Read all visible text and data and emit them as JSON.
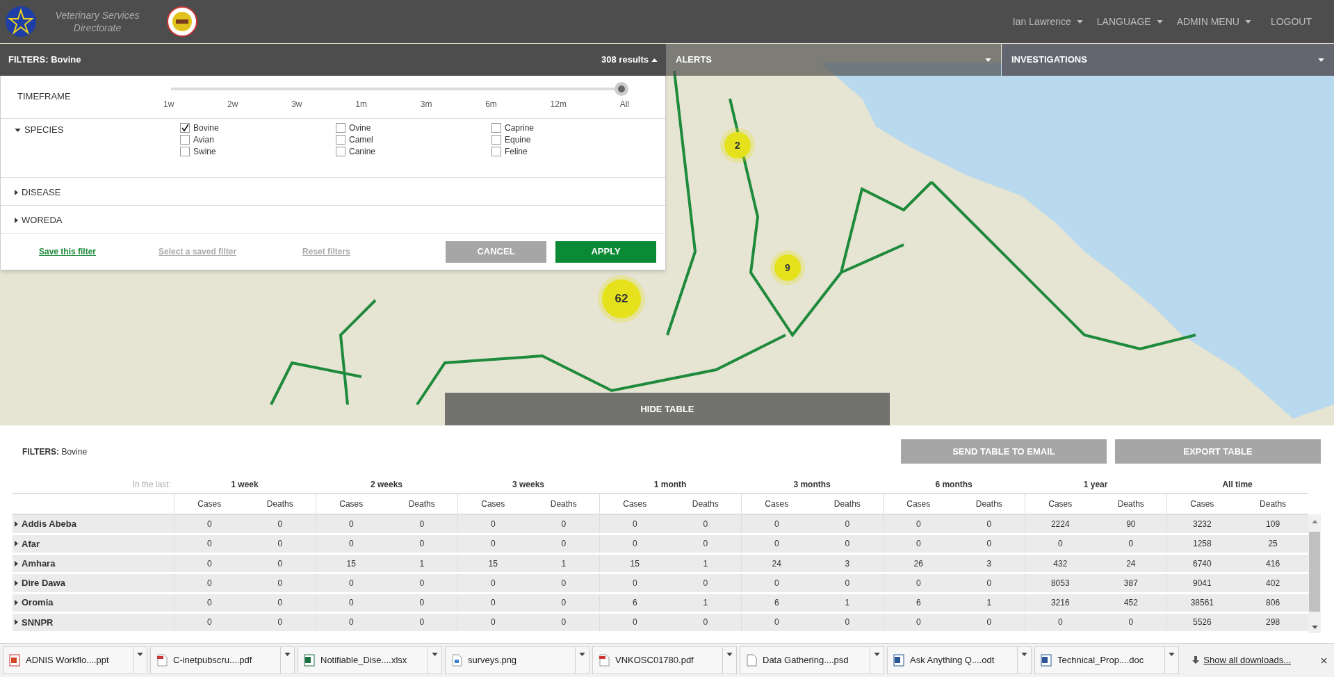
{
  "header": {
    "title": "Veterinary Services Directorate",
    "menu": [
      {
        "label": "Ian Lawrence",
        "dropdown": true
      },
      {
        "label": "LANGUAGE",
        "dropdown": true
      },
      {
        "label": "ADMIN MENU",
        "dropdown": true
      },
      {
        "label": "LOGOUT",
        "dropdown": false
      }
    ]
  },
  "filter_panel": {
    "title_label": "FILTERS:",
    "title_value": "Bovine",
    "results": "308 results",
    "expanded": true,
    "timeframe": {
      "label": "TIMEFRAME",
      "level": 1,
      "ticks": [
        "1w",
        "2w",
        "3w",
        "1m",
        "3m",
        "6m",
        "12m",
        "All"
      ]
    },
    "sections": [
      {
        "label": "SPECIES",
        "expanded": true,
        "options": [
          {
            "label": "Bovine",
            "checked": true
          },
          {
            "label": "Ovine",
            "checked": false
          },
          {
            "label": "Caprine",
            "checked": false
          },
          {
            "label": "Avian",
            "checked": false
          },
          {
            "label": "Camel",
            "checked": false
          },
          {
            "label": "Equine",
            "checked": false
          },
          {
            "label": "Swine",
            "checked": false
          },
          {
            "label": "Canine",
            "checked": false
          },
          {
            "label": "Feline",
            "checked": false
          }
        ]
      },
      {
        "label": "DISEASE",
        "expanded": false
      },
      {
        "label": "WOREDA",
        "expanded": false
      }
    ],
    "links": [
      {
        "label": "Save this filter",
        "disabled": false
      },
      {
        "label": "Select a saved filter",
        "disabled": true
      },
      {
        "label": "Reset filters",
        "disabled": true
      }
    ],
    "buttons": [
      {
        "label": "CANCEL",
        "kind": "cancel"
      },
      {
        "label": "APPLY",
        "kind": "apply"
      }
    ]
  },
  "panels": [
    {
      "label": "ALERTS",
      "expanded": false
    },
    {
      "label": "INVESTIGATIONS",
      "expanded": false
    }
  ],
  "map": {
    "markers": [
      {
        "count": "2"
      },
      {
        "count": "9"
      },
      {
        "count": "62"
      }
    ],
    "hide_table": "HIDE TABLE"
  },
  "table": {
    "filters_label": "FILTERS:",
    "filters_value": "Bovine",
    "buttons": [
      "SEND TABLE TO EMAIL",
      "EXPORT TABLE"
    ],
    "period_label": "In the last:",
    "periods": [
      {
        "label": "1 week",
        "columns": [
          "Cases",
          "Deaths"
        ]
      },
      {
        "label": "2 weeks",
        "columns": [
          "Cases",
          "Deaths"
        ]
      },
      {
        "label": "3 weeks",
        "columns": [
          "Cases",
          "Deaths"
        ]
      },
      {
        "label": "1 month",
        "columns": [
          "Cases",
          "Deaths"
        ]
      },
      {
        "label": "3 months",
        "columns": [
          "Cases",
          "Deaths"
        ]
      },
      {
        "label": "6 months",
        "columns": [
          "Cases",
          "Deaths"
        ]
      },
      {
        "label": "1 year",
        "columns": [
          "Cases",
          "Deaths"
        ]
      },
      {
        "label": "All time",
        "columns": [
          "Cases",
          "Deaths"
        ]
      }
    ],
    "rows": [
      {
        "region": "Addis Abeba",
        "expanded": false,
        "values": [
          "0",
          "0",
          "0",
          "0",
          "0",
          "0",
          "0",
          "0",
          "0",
          "0",
          "0",
          "0",
          "2224",
          "90",
          "3232",
          "109"
        ]
      },
      {
        "region": "Afar",
        "expanded": false,
        "values": [
          "0",
          "0",
          "0",
          "0",
          "0",
          "0",
          "0",
          "0",
          "0",
          "0",
          "0",
          "0",
          "0",
          "0",
          "1258",
          "25"
        ]
      },
      {
        "region": "Amhara",
        "expanded": false,
        "values": [
          "0",
          "0",
          "15",
          "1",
          "15",
          "1",
          "15",
          "1",
          "24",
          "3",
          "26",
          "3",
          "432",
          "24",
          "6740",
          "416"
        ]
      },
      {
        "region": "Dire Dawa",
        "expanded": false,
        "values": [
          "0",
          "0",
          "0",
          "0",
          "0",
          "0",
          "0",
          "0",
          "0",
          "0",
          "0",
          "0",
          "8053",
          "387",
          "9041",
          "402"
        ]
      },
      {
        "region": "Oromia",
        "expanded": false,
        "values": [
          "0",
          "0",
          "0",
          "0",
          "0",
          "0",
          "6",
          "1",
          "6",
          "1",
          "6",
          "1",
          "3216",
          "452",
          "38561",
          "806"
        ]
      },
      {
        "region": "SNNPR",
        "expanded": false,
        "values": [
          "0",
          "0",
          "0",
          "0",
          "0",
          "0",
          "0",
          "0",
          "0",
          "0",
          "0",
          "0",
          "0",
          "0",
          "5526",
          "298"
        ]
      }
    ]
  },
  "downloads": {
    "items": [
      {
        "name": "ADNIS Workflo....ppt",
        "kind": "ppt"
      },
      {
        "name": "C-inetpubscru....pdf",
        "kind": "pdf"
      },
      {
        "name": "Notifiable_Dise....xlsx",
        "kind": "xlsx"
      },
      {
        "name": "surveys.png",
        "kind": "png"
      },
      {
        "name": "VNKOSC01780.pdf",
        "kind": "pdf"
      },
      {
        "name": "Data Gathering....psd",
        "kind": "psd"
      },
      {
        "name": "Ask Anything Q....odt",
        "kind": "odt"
      },
      {
        "name": "Technical_Prop....doc",
        "kind": "doc"
      }
    ],
    "show_all": "Show all downloads..."
  }
}
